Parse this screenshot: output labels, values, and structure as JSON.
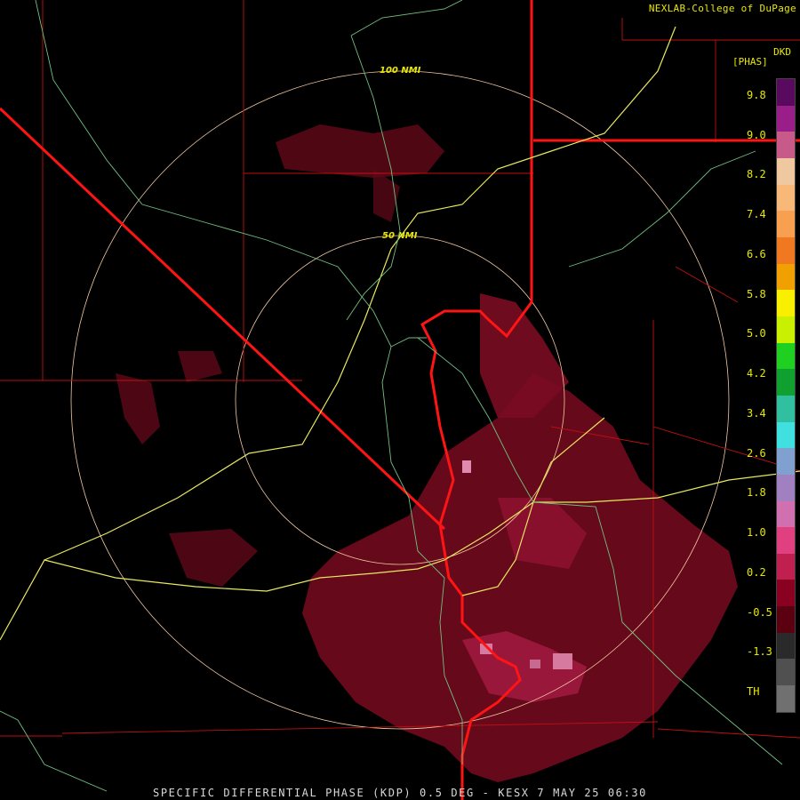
{
  "header": {
    "credit": "NEXLAB-College of DuPage"
  },
  "footer": {
    "caption": "SPECIFIC DIFFERENTIAL PHASE (KDP) 0.5 DEG - KESX 7 MAY 25 06:30"
  },
  "range_rings": {
    "inner_label": "50 NMI",
    "outer_label": "100 NMI"
  },
  "legend": {
    "unit": "DKD",
    "product": "[PHAS]",
    "ticks": [
      "9.8",
      "9.0",
      "8.2",
      "7.4",
      "6.6",
      "5.8",
      "5.0",
      "4.2",
      "3.4",
      "2.6",
      "1.8",
      "1.0",
      "0.2",
      "-0.5",
      "-1.3",
      "TH"
    ],
    "colors": [
      "#5a0a5e",
      "#9a1e8a",
      "#c85a8a",
      "#f0c8a0",
      "#f8b878",
      "#f8a050",
      "#f07820",
      "#f0a000",
      "#f8f000",
      "#c8f000",
      "#20d020",
      "#10a030",
      "#30c0a0",
      "#40e0e0",
      "#80a0d0",
      "#a080c0",
      "#d070b0",
      "#e04080",
      "#c02050",
      "#8a0020",
      "#5a0010",
      "#2a2a2a",
      "#505050",
      "#707070"
    ]
  }
}
